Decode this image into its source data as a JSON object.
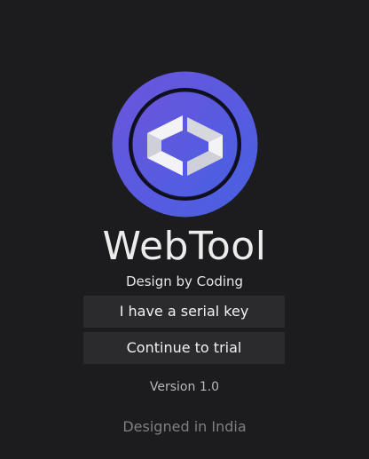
{
  "app": {
    "title": "WebTool",
    "tagline": "Design by Coding"
  },
  "logo": {
    "icon": "box-outline-icon",
    "gradient_start": "#6a56de",
    "gradient_end": "#4a5fe0",
    "inner_color": "#16162a",
    "shape_color": "#ebebf0"
  },
  "actions": {
    "serial_label": "I have a serial key",
    "trial_label": "Continue to trial"
  },
  "version": "Version 1.0",
  "footer": "Designed in India",
  "colors": {
    "background": "#1c1c1e",
    "button_bg": "#2b2b2e"
  }
}
